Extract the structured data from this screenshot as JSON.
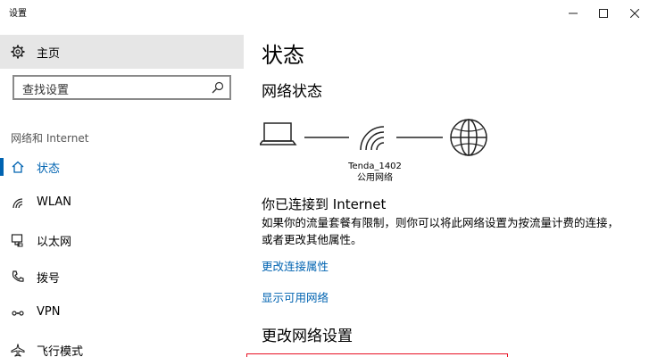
{
  "window": {
    "title": "设置"
  },
  "sidebar": {
    "home_label": "主页",
    "search_placeholder": "查找设置",
    "section_label": "网络和 Internet",
    "items": [
      {
        "label": "状态",
        "icon": "home-icon",
        "active": true
      },
      {
        "label": "WLAN",
        "icon": "wifi-icon"
      },
      {
        "label": "以太网",
        "icon": "ethernet-icon"
      },
      {
        "label": "拨号",
        "icon": "phone-icon"
      },
      {
        "label": "VPN",
        "icon": "vpn-icon"
      },
      {
        "label": "飞行模式",
        "icon": "airplane-icon"
      }
    ]
  },
  "main": {
    "title": "状态",
    "network_status_heading": "网络状态",
    "network": {
      "name": "Tenda_1402",
      "type": "公用网络"
    },
    "connected_title": "你已连接到 Internet",
    "connected_desc": "如果你的流量套餐有限制，则你可以将此网络设置为按流量计费的连接，或者更改其他属性。",
    "links": {
      "change_properties": "更改连接属性",
      "show_networks": "显示可用网络"
    },
    "change_settings_heading": "更改网络设置"
  },
  "colors": {
    "accent": "#0063b1",
    "sidebar_home_bg": "#e6e6e6",
    "highlight_box": "#e81123"
  }
}
